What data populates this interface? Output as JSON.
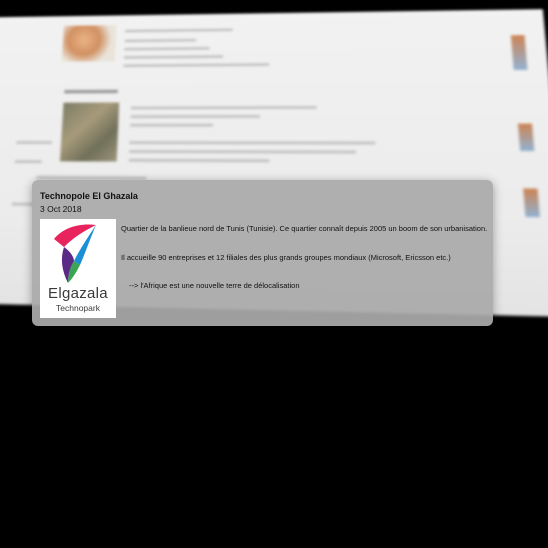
{
  "popup": {
    "title": "Technopole El Ghazala",
    "date": "3 Oct 2018",
    "paragraphs": [
      "Quartier de la banlieue nord de Tunis (Tunisie). Ce quartier connaît depuis 2005 un boom de son urbanisation.",
      "Il accueille 90 entreprises et 12 filiales des plus grands groupes mondiaux (Microsoft, Ericsson etc.)",
      "--> l'Afrique est une nouvelle terre de délocalisation"
    ],
    "logo": {
      "name": "Elgazala",
      "subtitle": "Technopark",
      "icon": "elgazala-logo-icon",
      "colors": [
        "#e8245e",
        "#1a8fd6",
        "#3aa655",
        "#5b2a86"
      ]
    }
  },
  "background": {
    "state": "blurred-tilted-page"
  }
}
